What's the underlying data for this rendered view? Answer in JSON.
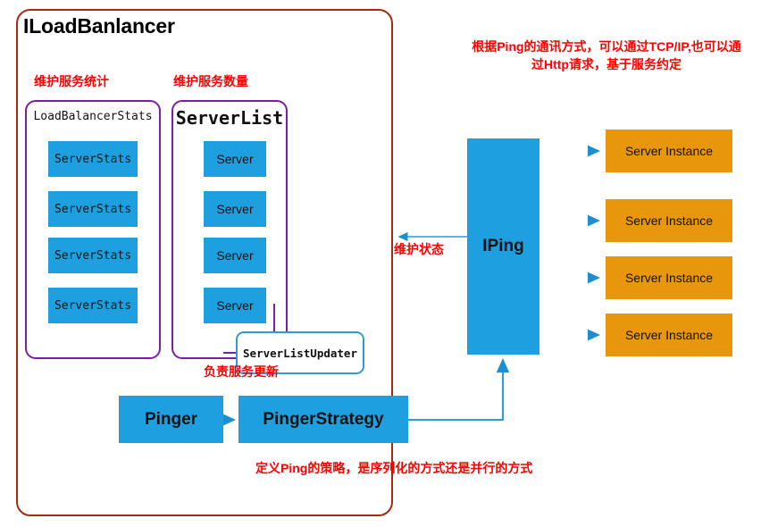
{
  "diagram": {
    "title": "ILoadBanlancer",
    "colors": {
      "outer_border": "#A52A11",
      "group_border": "#7B1FA2",
      "node_blue": "#1D9FE0",
      "node_orange": "#E8960C",
      "annotation_red": "#FF0000",
      "connector_blue": "#2E9BD6"
    }
  },
  "annotations": {
    "stats_label": "维护服务统计",
    "list_label": "维护服务数量",
    "ping_note": "根据Ping的通讯方式，可以通过TCP/IP,也可以通过Http请求，基于服务约定",
    "state_label": "维护状态",
    "updater_label": "负责服务更新",
    "strategy_note": "定义Ping的策略，是序列化的方式还是并行的方式"
  },
  "groups": {
    "stats": {
      "title": "LoadBalancerStats",
      "items": [
        {
          "label": "ServerStats"
        },
        {
          "label": "ServerStats"
        },
        {
          "label": "ServerStats"
        },
        {
          "label": "ServerStats"
        }
      ]
    },
    "list": {
      "title": "ServerList",
      "items": [
        {
          "label": "Server"
        },
        {
          "label": "Server"
        },
        {
          "label": "Server"
        },
        {
          "label": "Server"
        }
      ]
    }
  },
  "nodes": {
    "updater": "ServerListUpdater",
    "pinger": "Pinger",
    "pinger_strategy": "PingerStrategy",
    "iping": "IPing"
  },
  "instances": [
    {
      "label": "Server Instance"
    },
    {
      "label": "Server Instance"
    },
    {
      "label": "Server Instance"
    },
    {
      "label": "Server Instance"
    }
  ]
}
